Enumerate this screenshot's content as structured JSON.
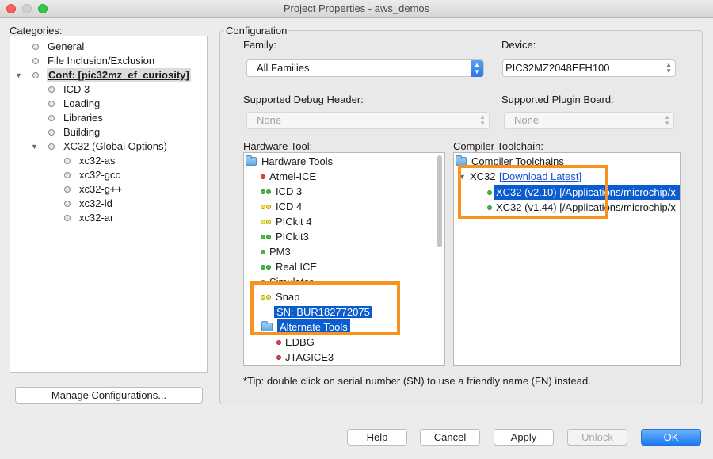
{
  "window": {
    "title": "Project Properties - aws_demos"
  },
  "categories": {
    "label": "Categories:",
    "items": [
      {
        "label": "General",
        "level": 1
      },
      {
        "label": "File Inclusion/Exclusion",
        "level": 1
      },
      {
        "label": "Conf: [pic32mz_ef_curiosity]",
        "level": 1
      },
      {
        "label": "ICD 3",
        "level": 2
      },
      {
        "label": "Loading",
        "level": 2
      },
      {
        "label": "Libraries",
        "level": 2
      },
      {
        "label": "Building",
        "level": 2
      },
      {
        "label": "XC32 (Global Options)",
        "level": 2
      },
      {
        "label": "xc32-as",
        "level": 3
      },
      {
        "label": "xc32-gcc",
        "level": 3
      },
      {
        "label": "xc32-g++",
        "level": 3
      },
      {
        "label": "xc32-ld",
        "level": 3
      },
      {
        "label": "xc32-ar",
        "level": 3
      }
    ],
    "manage_button": "Manage Configurations..."
  },
  "configuration": {
    "title": "Configuration",
    "family": {
      "label": "Family:",
      "value": "All Families"
    },
    "device": {
      "label": "Device:",
      "value": "PIC32MZ2048EFH100"
    },
    "debug_header": {
      "label": "Supported Debug Header:",
      "value": "None"
    },
    "plugin_board": {
      "label": "Supported Plugin Board:",
      "value": "None"
    },
    "hardware_tool": {
      "label": "Hardware Tool:",
      "items": [
        {
          "label": "Hardware Tools",
          "type": "folder"
        },
        {
          "label": "Atmel-ICE",
          "status": "r"
        },
        {
          "label": "ICD 3",
          "status": "gg"
        },
        {
          "label": "ICD 4",
          "status": "yy"
        },
        {
          "label": "PICkit 4",
          "status": "yy"
        },
        {
          "label": "PICkit3",
          "status": "gg"
        },
        {
          "label": "PM3",
          "status": "g"
        },
        {
          "label": "Real ICE",
          "status": "gg"
        },
        {
          "label": "Simulator",
          "status": "g"
        },
        {
          "label": "Snap",
          "status": "yy"
        },
        {
          "label": "SN: BUR182772075",
          "type": "serial"
        },
        {
          "label": "Alternate Tools",
          "type": "folder"
        },
        {
          "label": "EDBG",
          "status": "r"
        },
        {
          "label": "JTAGICE3",
          "status": "r"
        }
      ]
    },
    "compiler_toolchain": {
      "label": "Compiler Toolchain:",
      "root": "Compiler Toolchains",
      "group": "XC32",
      "download_link": "[Download Latest]",
      "items": [
        {
          "label": "XC32 (v2.10) [/Applications/microchip/x",
          "selected": true
        },
        {
          "label": "XC32 (v1.44) [/Applications/microchip/x",
          "selected": false
        }
      ]
    },
    "tip": "*Tip: double click on serial number (SN) to use a friendly name (FN) instead."
  },
  "buttons": {
    "help": "Help",
    "cancel": "Cancel",
    "apply": "Apply",
    "unlock": "Unlock",
    "ok": "OK"
  },
  "colors": {
    "highlight": "#f7931e",
    "selection": "#0b5ccf",
    "primary_button": "#1b7bf3"
  }
}
